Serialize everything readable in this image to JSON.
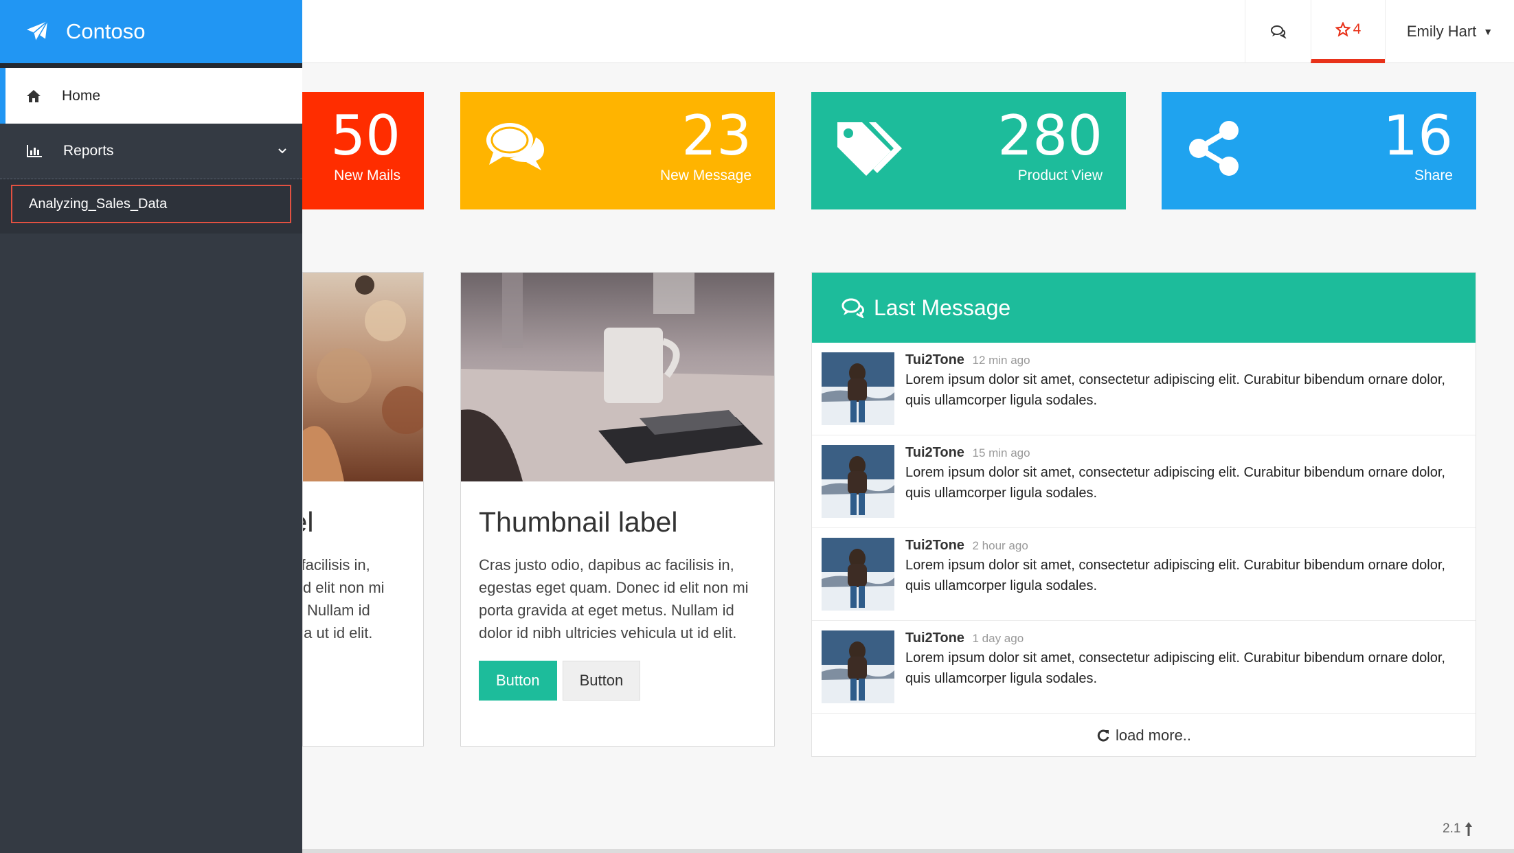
{
  "app": {
    "brand": "Contoso"
  },
  "sidebar": {
    "items": [
      {
        "label": "Home",
        "icon": "home-icon"
      },
      {
        "label": "Reports",
        "icon": "bar-chart-icon"
      }
    ],
    "sub_items": [
      {
        "label": "Analyzing_Sales_Data"
      }
    ]
  },
  "topbar": {
    "favorites_count": "4",
    "user_name": "Emily Hart"
  },
  "stats": [
    {
      "value": "50",
      "label": "New Mails",
      "color": "#ff2d00",
      "icon": "mail-icon"
    },
    {
      "value": "23",
      "label": "New Message",
      "color": "#ffb400",
      "icon": "comments-icon"
    },
    {
      "value": "280",
      "label": "Product View",
      "color": "#1dbc9b",
      "icon": "tags-icon"
    },
    {
      "value": "16",
      "label": "Share",
      "color": "#1fa3ef",
      "icon": "share-icon"
    }
  ],
  "thumbnails": [
    {
      "title": "Thumbnail label",
      "text": "Cras justo odio, dapibus ac facilisis in, egestas eget quam. Donec id elit non mi porta gravida at eget metus. Nullam id dolor id nibh ultricies vehicula ut id elit."
    },
    {
      "title": "Thumbnail label",
      "text": "Cras justo odio, dapibus ac facilisis in, egestas eget quam. Donec id elit non mi porta gravida at eget metus. Nullam id dolor id nibh ultricies vehicula ut id elit.",
      "primary_button": "Button",
      "default_button": "Button"
    }
  ],
  "messages_panel": {
    "title": "Last Message",
    "messages": [
      {
        "author": "Tui2Tone",
        "time": "12 min ago",
        "text": "Lorem ipsum dolor sit amet, consectetur adipiscing elit. Curabitur bibendum ornare dolor, quis ullamcorper ligula sodales."
      },
      {
        "author": "Tui2Tone",
        "time": "15 min ago",
        "text": "Lorem ipsum dolor sit amet, consectetur adipiscing elit. Curabitur bibendum ornare dolor, quis ullamcorper ligula sodales."
      },
      {
        "author": "Tui2Tone",
        "time": "2 hour ago",
        "text": "Lorem ipsum dolor sit amet, consectetur adipiscing elit. Curabitur bibendum ornare dolor, quis ullamcorper ligula sodales."
      },
      {
        "author": "Tui2Tone",
        "time": "1 day ago",
        "text": "Lorem ipsum dolor sit amet, consectetur adipiscing elit. Curabitur bibendum ornare dolor, quis ullamcorper ligula sodales."
      }
    ],
    "load_more": "load more.."
  },
  "footer": {
    "version": "2.1"
  }
}
